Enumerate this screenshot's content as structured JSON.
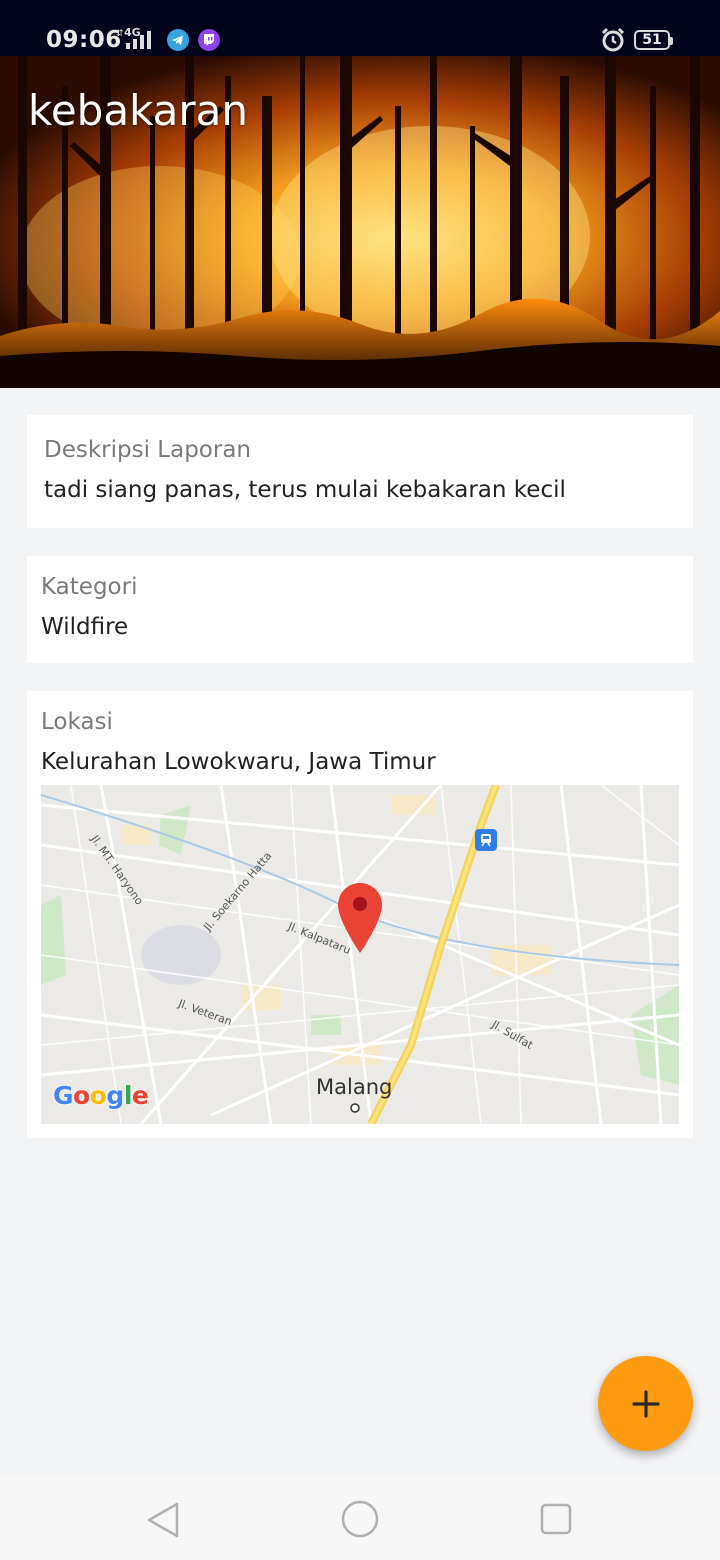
{
  "status_bar": {
    "time": "09:06",
    "network": "4G",
    "battery": "51",
    "icons": [
      "signal-icon",
      "telegram-icon",
      "twitch-icon",
      "alarm-icon",
      "battery-icon"
    ]
  },
  "header": {
    "title": "kebakaran",
    "image": "forest-fire-photo"
  },
  "description_card": {
    "label": "Deskripsi Laporan",
    "value": "tadi siang panas, terus mulai kebakaran kecil"
  },
  "category_card": {
    "label": "Kategori",
    "value": "Wildfire"
  },
  "location_card": {
    "label": "Lokasi",
    "value": "Kelurahan Lowokwaru, Jawa Timur",
    "map": {
      "city": "Malang",
      "streets": [
        "Jl. MT. Haryono",
        "Jl. Soekarno Hatta",
        "Jl. Kalpataru",
        "Jl. Veteran",
        "Jl. Sulfat"
      ],
      "provider": "Google"
    }
  },
  "fab": {
    "icon": "plus-icon",
    "color": "#ff9b10"
  },
  "nav_bar": {
    "icons": [
      "back-icon",
      "home-icon",
      "recents-icon"
    ]
  },
  "colors": {
    "accent": "#ff9b10",
    "pin": "#ea4335",
    "status_bar": "#01041a"
  }
}
